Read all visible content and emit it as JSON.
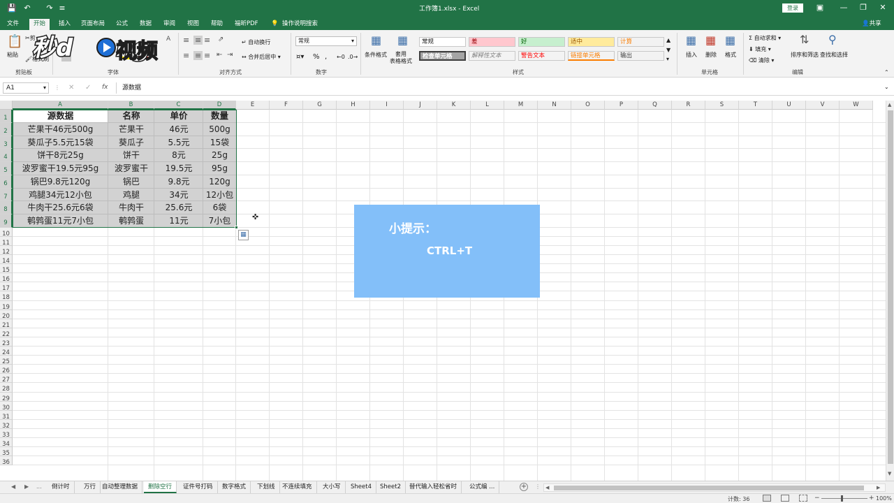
{
  "titlebar": {
    "title": "工作簿1.xlsx  -  Excel",
    "login": "登录",
    "save_icon": "save-icon",
    "undo_icon": "undo-icon",
    "redo_icon": "redo-icon"
  },
  "tabs": [
    "文件",
    "开始",
    "插入",
    "页面布局",
    "公式",
    "数据",
    "审阅",
    "视图",
    "帮助",
    "福昕PDF",
    "操作说明搜索"
  ],
  "share": "共享",
  "ribbon": {
    "clipboard": {
      "paste": "粘贴",
      "cut": "剪",
      "format_painter": "格式刷",
      "label": "剪贴板"
    },
    "font": {
      "label": "字体"
    },
    "align": {
      "wrap": "自动换行",
      "merge": "合并后居中",
      "label": "对齐方式"
    },
    "number": {
      "format": "常规",
      "percent": "%",
      "comma": ",",
      "label": "数字"
    },
    "styles": {
      "cond": "条件格式",
      "table": "套用\n表格格式",
      "cells": [
        {
          "text": "常规",
          "bg": "#ffffff",
          "color": "#222222"
        },
        {
          "text": "差",
          "bg": "#ffc7ce",
          "color": "#9c0006"
        },
        {
          "text": "好",
          "bg": "#c6efce",
          "color": "#006100"
        },
        {
          "text": "适中",
          "bg": "#ffeb9c",
          "color": "#9c5700"
        },
        {
          "text": "计算",
          "bg": "#f2f2f2",
          "color": "#fa7d00"
        },
        {
          "text": "检查单元格",
          "bg": "#a5a5a5",
          "color": "#ffffff"
        },
        {
          "text": "解释性文本",
          "bg": "#f3f3f3",
          "color": "#7f7f7f"
        },
        {
          "text": "警告文本",
          "bg": "#f3f3f3",
          "color": "#ff0000"
        },
        {
          "text": "链接单元格",
          "bg": "#f3f3f3",
          "color": "#fa7d00"
        },
        {
          "text": "输出",
          "bg": "#f2f2f2",
          "color": "#3f3f3f"
        }
      ],
      "label": "样式"
    },
    "cellsgrp": {
      "insert": "插入",
      "delete": "删除",
      "format": "格式",
      "label": "单元格"
    },
    "editing": {
      "autosum": "自动求和",
      "fill": "填充",
      "clear": "清除",
      "sort": "排序和筛选",
      "find": "查找和选择",
      "label": "编辑"
    }
  },
  "watermark": {
    "text": "秒dong视频"
  },
  "formula": {
    "namebox": "A1",
    "fx": "fx",
    "content": "源数据"
  },
  "columns": [
    "A",
    "B",
    "C",
    "D",
    "E",
    "F",
    "G",
    "H",
    "I",
    "J",
    "K",
    "L",
    "M",
    "N",
    "O",
    "P",
    "Q",
    "R",
    "S",
    "T",
    "U",
    "V",
    "W"
  ],
  "rows": [
    "1",
    "2",
    "3",
    "4",
    "5",
    "6",
    "7",
    "8",
    "9",
    "10",
    "11",
    "12",
    "14",
    "15",
    "16",
    "17",
    "18",
    "19",
    "20",
    "21",
    "22",
    "23",
    "24",
    "25",
    "26",
    "27",
    "28",
    "29",
    "30",
    "31",
    "32",
    "33",
    "34",
    "35",
    "36"
  ],
  "table": {
    "headers": [
      "源数据",
      "名称",
      "单价",
      "数量"
    ],
    "data": [
      [
        "芒果干46元500g",
        "芒果干",
        "46元",
        "500g"
      ],
      [
        "葵瓜子5.5元15袋",
        "葵瓜子",
        "5.5元",
        "15袋"
      ],
      [
        "饼干8元25g",
        "饼干",
        "8元",
        "25g"
      ],
      [
        "波罗蜜干19.5元95g",
        "波罗蜜干",
        "19.5元",
        "95g"
      ],
      [
        "锅巴9.8元120g",
        "锅巴",
        "9.8元",
        "120g"
      ],
      [
        "鸡腿34元12小包",
        "鸡腿",
        "34元",
        "12小包"
      ],
      [
        "牛肉干25.6元6袋",
        "牛肉干",
        "25.6元",
        "6袋"
      ],
      [
        "鹌鹑蛋11元7小包",
        "鹌鹑蛋",
        "11元",
        "7小包"
      ]
    ]
  },
  "tip": {
    "title": "小提示：",
    "shortcut": "CTRL+T"
  },
  "sheets": [
    "倒计时",
    "万行",
    "自动整理数据",
    "删除空行",
    "证件号打码",
    "数字格式",
    "下划线",
    "不连续填充",
    "大小写",
    "Sheet4",
    "Sheet2",
    "替代输入轻松省时",
    "公式编 ..."
  ],
  "active_sheet": 3,
  "status": {
    "count": "计数: 36",
    "zoom": "100%"
  }
}
